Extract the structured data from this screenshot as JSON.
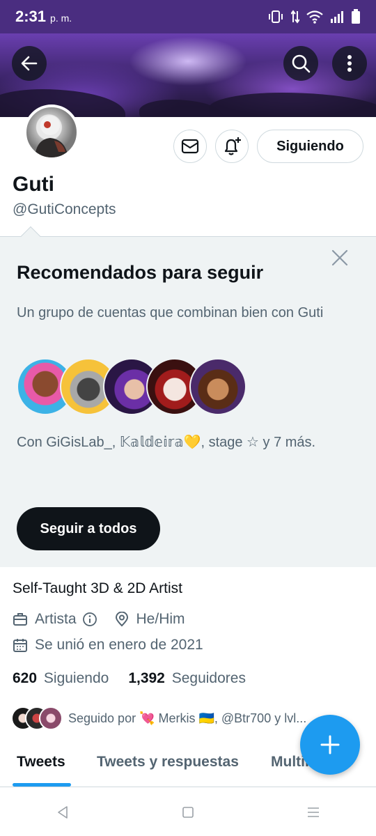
{
  "status_bar": {
    "time": "2:31",
    "ampm": "p. m."
  },
  "profile": {
    "name": "Guti",
    "handle": "@GutiConcepts",
    "following_button": "Siguiendo",
    "bio": "Self-Taught 3D & 2D Artist",
    "category": "Artista",
    "pronouns": "He/Him",
    "joined": "Se unió en enero de 2021",
    "following_count": "620",
    "following_label": "Siguiendo",
    "followers_count": "1,392",
    "followers_label": "Seguidores",
    "followed_by": "Seguido por 💘 Merkis 🇺🇦, @Btr700 y lvl..."
  },
  "recommendations": {
    "title": "Recomendados para seguir",
    "description": "Un grupo de cuentas que combinan bien con Guti",
    "names": "Con GiGisLab_, 𝕂𝕒𝕝𝕕𝕖𝕚𝕣𝕒💛, stage ☆ y 7 más.",
    "follow_all": "Seguir a todos"
  },
  "tabs": [
    {
      "label": "Tweets"
    },
    {
      "label": "Tweets y respuestas"
    },
    {
      "label": "Multimedia"
    }
  ],
  "colors": {
    "accent": "#1d9bf0",
    "status_bar": "#4a2d80",
    "card_bg": "#eff3f4",
    "text_secondary": "#536471"
  },
  "icons": [
    "back-arrow-icon",
    "search-icon",
    "more-vert-icon",
    "mail-icon",
    "bell-plus-icon",
    "close-icon",
    "briefcase-icon",
    "info-icon",
    "location-icon",
    "calendar-icon",
    "plus-icon",
    "nav-back-icon",
    "nav-home-icon",
    "nav-recents-icon"
  ]
}
